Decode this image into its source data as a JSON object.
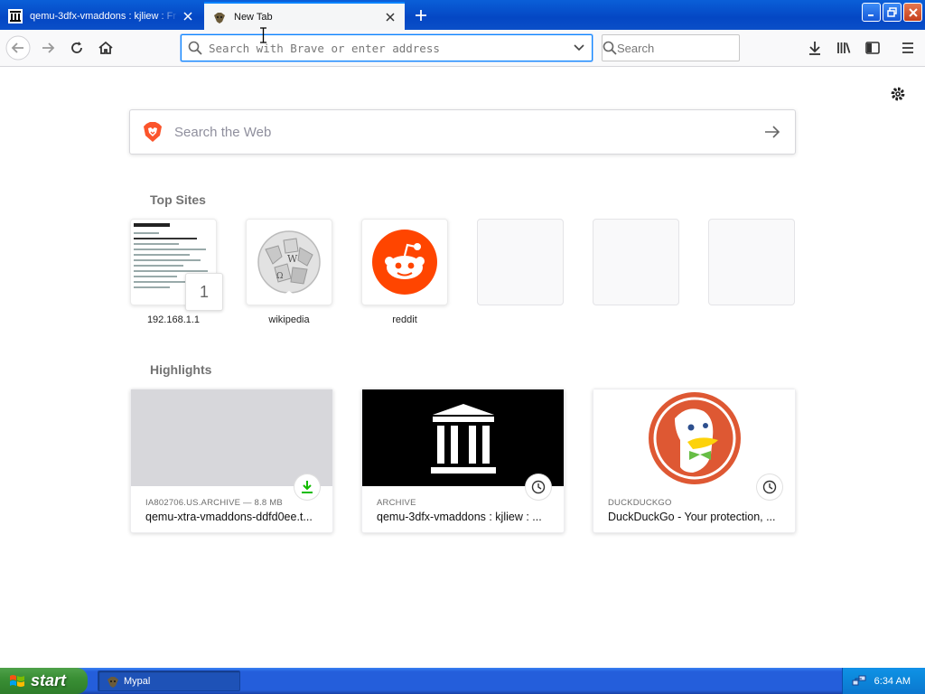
{
  "tabs": [
    {
      "title": "qemu-3dfx-vmaddons : kjliew : Fr",
      "favicon": "archive-building-icon",
      "active": false
    },
    {
      "title": "New Tab",
      "favicon": "brave-lion-icon",
      "active": true
    }
  ],
  "toolbar": {
    "url_placeholder": "Search with Brave or enter address",
    "search_placeholder": "Search"
  },
  "newtab": {
    "search_placeholder": "Search the Web",
    "top_sites_label": "Top Sites",
    "highlights_label": "Highlights",
    "top_sites": [
      {
        "label": "192.168.1.1",
        "badge": "1"
      },
      {
        "label": "wikipedia"
      },
      {
        "label": "reddit"
      },
      {
        "label": ""
      },
      {
        "label": ""
      },
      {
        "label": ""
      }
    ],
    "highlights": [
      {
        "meta": "IA802706.US.ARCHIVE — 8.8 MB",
        "title": "qemu-xtra-vmaddons-ddfd0ee.t...",
        "action_icon": "download-icon"
      },
      {
        "meta": "ARCHIVE",
        "title": "qemu-3dfx-vmaddons : kjliew : ...",
        "action_icon": "clock-icon"
      },
      {
        "meta": "DUCKDUCKGO",
        "title": "DuckDuckGo - Your protection, ...",
        "action_icon": "clock-icon"
      }
    ]
  },
  "taskbar": {
    "start_label": "start",
    "task_label": "Mypal",
    "clock": "6:34 AM"
  },
  "colors": {
    "accent": "#0a84ff",
    "reddit": "#ff4500",
    "duckduckgo": "#de5833",
    "download_green": "#12bc00"
  }
}
